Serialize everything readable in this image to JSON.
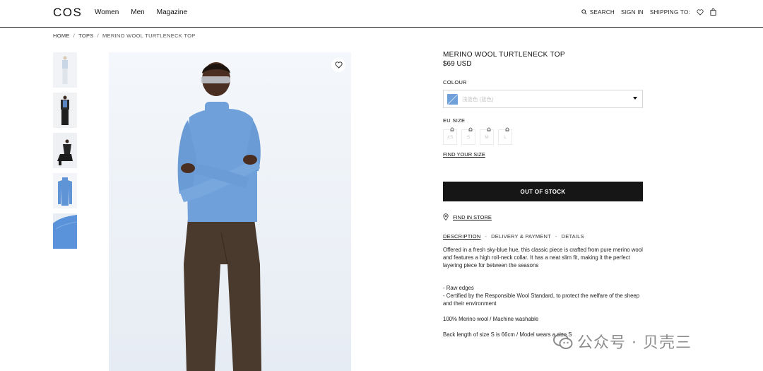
{
  "header": {
    "logo": "COS",
    "nav": [
      "Women",
      "Men",
      "Magazine"
    ],
    "search_label": "SEARCH",
    "sign_in_label": "SIGN IN",
    "shipping_label": "SHIPPING TO:"
  },
  "breadcrumb": {
    "home": "HOME",
    "sep": "/",
    "category": "TOPS",
    "current": "MERINO WOOL TURTLENECK TOP"
  },
  "product": {
    "title": "MERINO WOOL TURTLENECK TOP",
    "price": "$69 USD",
    "colour_label": "COLOUR",
    "colour_value": "浅蓝色 (蓝色)",
    "colour_hex": "#6fa0d9",
    "size_label": "EU SIZE",
    "sizes": [
      "XS",
      "S",
      "M",
      "L"
    ],
    "find_size": "FIND YOUR SIZE",
    "cta": "OUT OF STOCK",
    "find_in_store": "FIND IN STORE"
  },
  "tabs": {
    "description": "DESCRIPTION",
    "delivery": "DELIVERY & PAYMENT",
    "details": "DETAILS",
    "separator": "-"
  },
  "description": {
    "intro": "Offered in a fresh sky-blue hue, this classic piece is crafted from pure merino wool and features a high roll-neck collar. It has a neat slim fit, making it the perfect layering piece for between the seasons",
    "bullet1": "- Raw edges",
    "bullet2": "- Certified by the Responsible Wool Standard, to protect the welfare of the sheep and their environment",
    "composition": "100% Merino wool / Machine washable",
    "fit": "Back length of size S is 66cm / Model wears a size S"
  },
  "watermark": {
    "text": "公众号 · 贝壳三"
  },
  "colors": {
    "button_bg": "#161616",
    "sweater_blue": "#6fa0d9",
    "trousers_brown": "#4a3a2e"
  }
}
